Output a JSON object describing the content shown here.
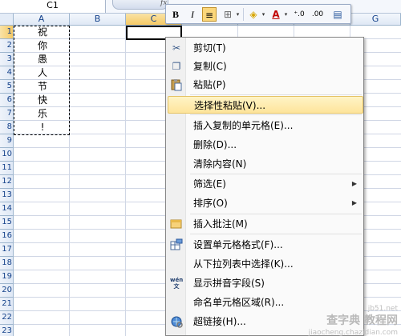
{
  "name_box": "C1",
  "fx_label": "fx",
  "columns": [
    {
      "label": "A",
      "selected": false
    },
    {
      "label": "B",
      "selected": false
    },
    {
      "label": "C",
      "selected": true
    },
    {
      "label": "G",
      "selected": false
    }
  ],
  "rows": [
    "1",
    "2",
    "3",
    "4",
    "5",
    "6",
    "7",
    "8",
    "9",
    "10",
    "11",
    "12",
    "13",
    "14",
    "15",
    "16",
    "17",
    "18",
    "19",
    "20",
    "21",
    "22",
    "23"
  ],
  "selected_row": "1",
  "cells_a": [
    "祝",
    "你",
    "愚",
    "人",
    "节",
    "快",
    "乐",
    "!"
  ],
  "mini_toolbar": {
    "bold": "B",
    "italic": "I",
    "align_center_icon": "≡",
    "borders_icon": "⊞",
    "fill_icon": "◈",
    "font_color": "A",
    "increase_decimal": "⁺.0",
    "decrease_decimal": ".00",
    "format_icon": "▤",
    "dropdown": "▾"
  },
  "context_menu": {
    "items": [
      {
        "label": "剪切(T)",
        "icon": "scissors-icon",
        "glyph": "✂"
      },
      {
        "label": "复制(C)",
        "icon": "copy-icon",
        "glyph": "❐"
      },
      {
        "label": "粘贴(P)",
        "icon": "paste-icon",
        "glyph": "📋"
      },
      {
        "label": "选择性粘贴(V)...",
        "highlighted": true
      },
      {
        "label": "插入复制的单元格(E)..."
      },
      {
        "label": "删除(D)..."
      },
      {
        "label": "清除内容(N)"
      },
      {
        "label": "筛选(E)",
        "submenu": true
      },
      {
        "label": "排序(O)",
        "submenu": true
      },
      {
        "label": "插入批注(M)",
        "icon": "comment-icon"
      },
      {
        "label": "设置单元格格式(F)...",
        "icon": "format-cells-icon"
      },
      {
        "label": "从下拉列表中选择(K)..."
      },
      {
        "label": "显示拼音字段(S)",
        "icon": "pinyin-icon",
        "glyph": "wén 文"
      },
      {
        "label": "命名单元格区域(R)..."
      },
      {
        "label": "超链接(H)...",
        "icon": "hyperlink-icon"
      }
    ],
    "submenu_arrow": "▶"
  },
  "watermark": {
    "main": "查字典 教程网",
    "url": "jiaocheng.chazidian.com",
    "site": "jb51.net"
  }
}
